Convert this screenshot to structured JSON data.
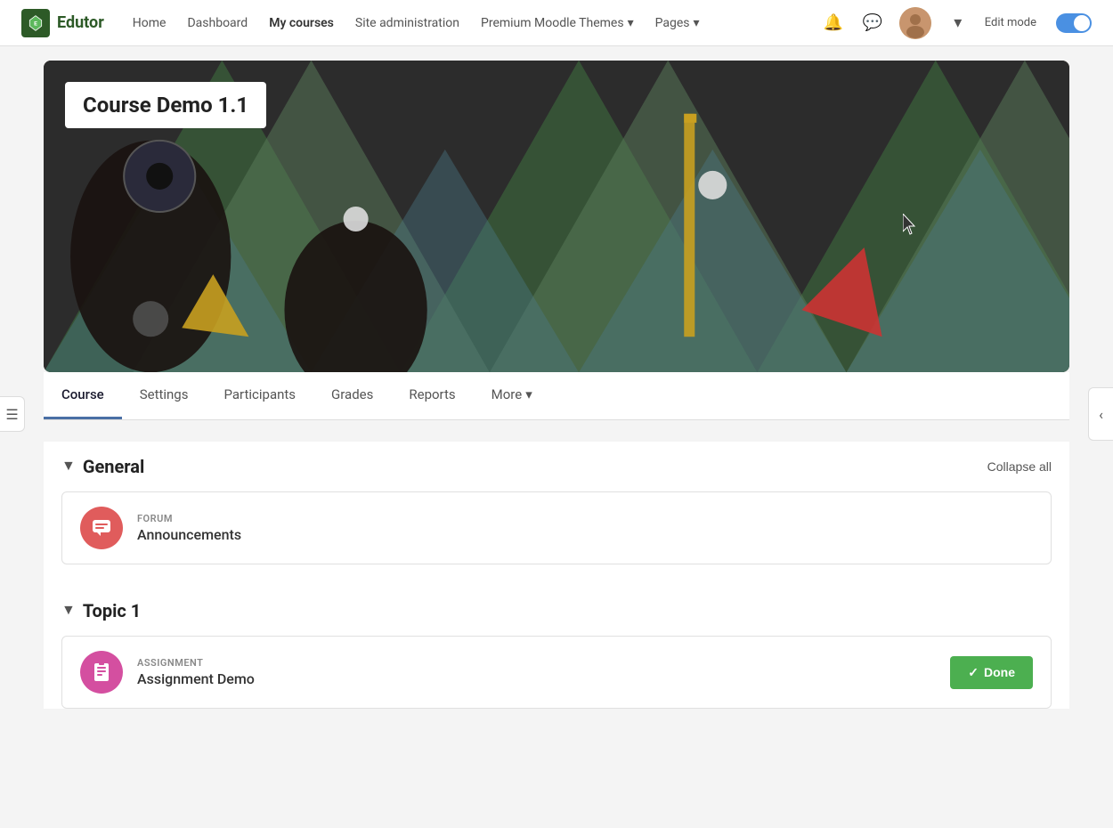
{
  "brand": {
    "name": "Edutor"
  },
  "navbar": {
    "links": [
      {
        "label": "Home",
        "active": false
      },
      {
        "label": "Dashboard",
        "active": false
      },
      {
        "label": "My courses",
        "active": true
      },
      {
        "label": "Site administration",
        "active": false
      },
      {
        "label": "Premium Moodle Themes",
        "active": false,
        "dropdown": true
      },
      {
        "label": "Pages",
        "active": false,
        "dropdown": true
      }
    ],
    "edit_mode_label": "Edit mode"
  },
  "course": {
    "title": "Course Demo 1.1"
  },
  "tabs": [
    {
      "label": "Course",
      "active": true
    },
    {
      "label": "Settings",
      "active": false
    },
    {
      "label": "Participants",
      "active": false
    },
    {
      "label": "Grades",
      "active": false
    },
    {
      "label": "Reports",
      "active": false
    },
    {
      "label": "More",
      "active": false,
      "dropdown": true
    }
  ],
  "sections": [
    {
      "id": "general",
      "title": "General",
      "collapsed": false,
      "activities": [
        {
          "type": "FORUM",
          "name": "Announcements",
          "icon_type": "forum"
        }
      ]
    },
    {
      "id": "topic1",
      "title": "Topic 1",
      "collapsed": false,
      "activities": [
        {
          "type": "ASSIGNMENT",
          "name": "Assignment Demo",
          "icon_type": "assignment",
          "done": true,
          "done_label": "Done"
        }
      ]
    }
  ],
  "collapse_all_label": "Collapse all",
  "checkmark": "✓"
}
